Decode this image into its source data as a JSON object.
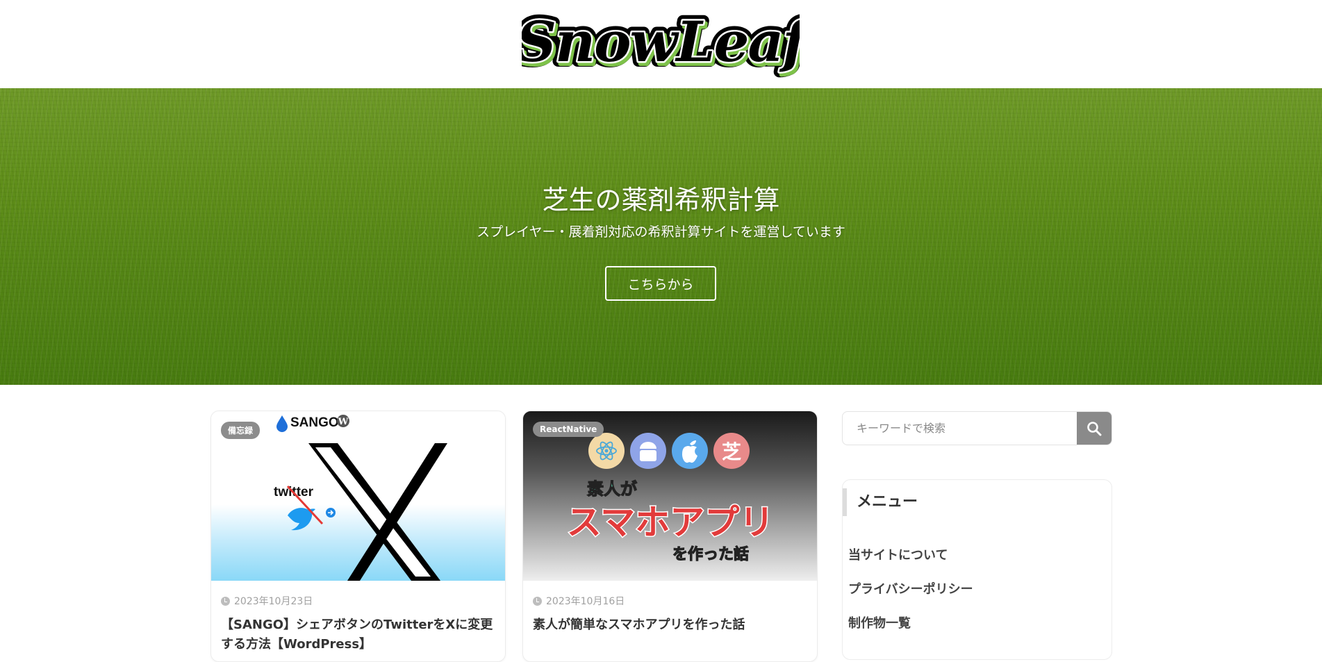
{
  "header": {
    "logo_text": "SnowLeaf",
    "logo_icon": "snowleaf-logo"
  },
  "hero": {
    "title": "芝生の薬剤希釈計算",
    "subtitle": "スプレイヤー・展着剤対応の希釈計算サイトを運営しています",
    "button_label": "こちらから"
  },
  "posts": [
    {
      "category": "備忘録",
      "date": "2023年10月23日",
      "title": "【SANGO】シェアボタンのTwitterをXに変更する方法【WordPress】",
      "thumb_brand": "SANGO",
      "thumb_twitter_word": "twitter"
    },
    {
      "category": "ReactNative",
      "date": "2023年10月16日",
      "title": "素人が簡単なスマホアプリを作った話",
      "thumb_top": "素人が",
      "thumb_main": "スマホアプリ",
      "thumb_bottom": "を作った話",
      "thumb_kanji": "芝"
    }
  ],
  "sidebar": {
    "search_placeholder": "キーワードで検索",
    "menu_heading": "メニュー",
    "menu_items": [
      "当サイトについて",
      "プライバシーポリシー",
      "制作物一覧"
    ]
  },
  "colors": {
    "hero_grass": "#6a9d1e",
    "badge_gray": "#8c8c8c",
    "logo_green": "#7ec24a",
    "app_red": "#e23b3b",
    "app_teal": "#5ecfae"
  }
}
